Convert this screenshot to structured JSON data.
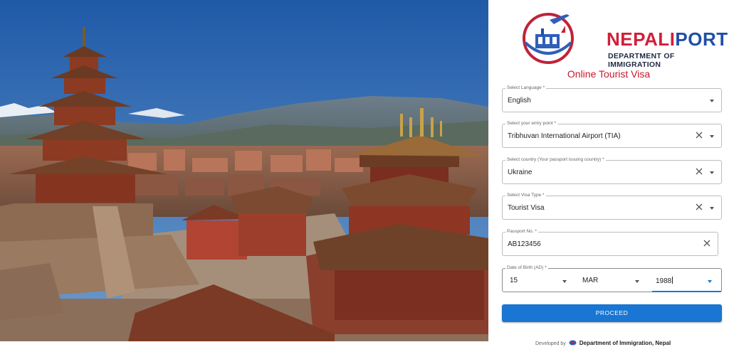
{
  "logo": {
    "name_part1": "NEPALI",
    "name_part2": "PORT",
    "subtitle": "DEPARTMENT OF IMMIGRATION"
  },
  "form": {
    "title": "Online Tourist Visa",
    "language": {
      "label": "Select Language *",
      "value": "English"
    },
    "entry_point": {
      "label": "Select your entry point *",
      "value": "Tribhuvan International Airport (TIA)"
    },
    "country": {
      "label": "Select country (Your passport issuing country) *",
      "value": "Ukraine"
    },
    "visa_type": {
      "label": "Select Visa Type *",
      "value": "Tourist Visa"
    },
    "passport": {
      "label": "Passport No. *",
      "value": "AB123456"
    },
    "dob": {
      "label": "Date of Birth (AD) *",
      "day": "15",
      "month": "MAR",
      "year": "1988"
    },
    "proceed_label": "PROCEED"
  },
  "footer": {
    "developed_by": "Developed by",
    "department": "Department of Immigration, Nepal"
  },
  "colors": {
    "brand_red": "#d11f3a",
    "brand_blue": "#1f4fa6",
    "title_red": "#c8182c",
    "primary": "#1976d2"
  },
  "icons": {
    "clear": "clear-x-icon",
    "dropdown": "chevron-down-icon",
    "emblem": "nepal-emblem-icon"
  }
}
